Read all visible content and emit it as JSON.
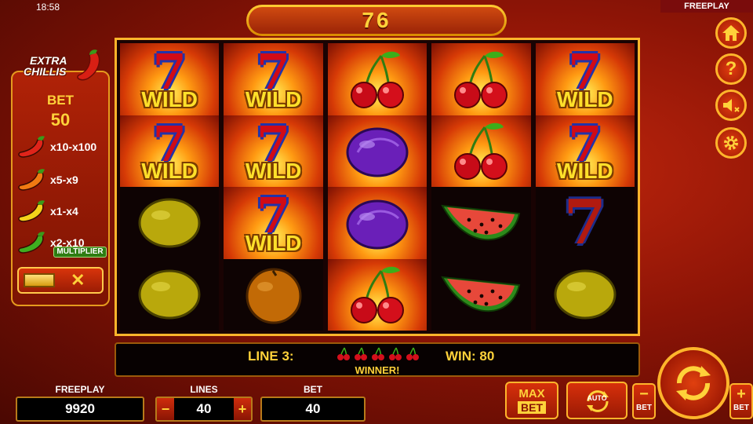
{
  "status": {
    "time": "18:58",
    "mode": "FREEPLAY"
  },
  "top_counter": "76",
  "logo": {
    "line1": "EXTRA",
    "line2": "CHILLIS"
  },
  "side_panel": {
    "bet_label": "BET",
    "bet_value": "50",
    "multipliers": [
      {
        "color": "#e0241a",
        "label": "x10-x100"
      },
      {
        "color": "#f07a12",
        "label": "x5-x9"
      },
      {
        "color": "#f4d21a",
        "label": "x1-x4"
      },
      {
        "color": "#3fae20",
        "label": "x2-x10"
      }
    ],
    "multiplier_badge": "MULTIPLIER",
    "toggle_close": "✕"
  },
  "reels": [
    [
      "wild",
      "wild",
      "lemon",
      "lemon"
    ],
    [
      "wild",
      "wild",
      "wild",
      "orange"
    ],
    [
      "cherry",
      "plum",
      "plum",
      "cherry"
    ],
    [
      "cherry",
      "cherry",
      "watermelon",
      "watermelon"
    ],
    [
      "wild",
      "wild",
      "seven",
      "lemon"
    ]
  ],
  "symbol_text": {
    "wild": "WILD"
  },
  "win_info": {
    "line": "LINE 3:",
    "line_symbol": "cherry",
    "line_symbol_count": 5,
    "win": "WIN: 80",
    "message": "WINNER!"
  },
  "bottom": {
    "freeplay_label": "FREEPLAY",
    "freeplay_value": "9920",
    "lines_label": "LINES",
    "lines_value": "40",
    "bet_label": "BET",
    "bet_value": "40",
    "lines_minus": "−",
    "lines_plus": "+",
    "max_bet_top": "MAX",
    "max_bet_bottom": "BET",
    "auto_label": "AUTO",
    "bet_minus_symbol": "−",
    "bet_plus_symbol": "+",
    "bet_small_label": "BET"
  },
  "side_buttons": [
    "home-icon",
    "help-icon",
    "sound-off-icon",
    "settings-gear-icon"
  ],
  "colors": {
    "accent": "#ffd23a",
    "frame": "#ffb52b",
    "background": "#8c1406"
  }
}
